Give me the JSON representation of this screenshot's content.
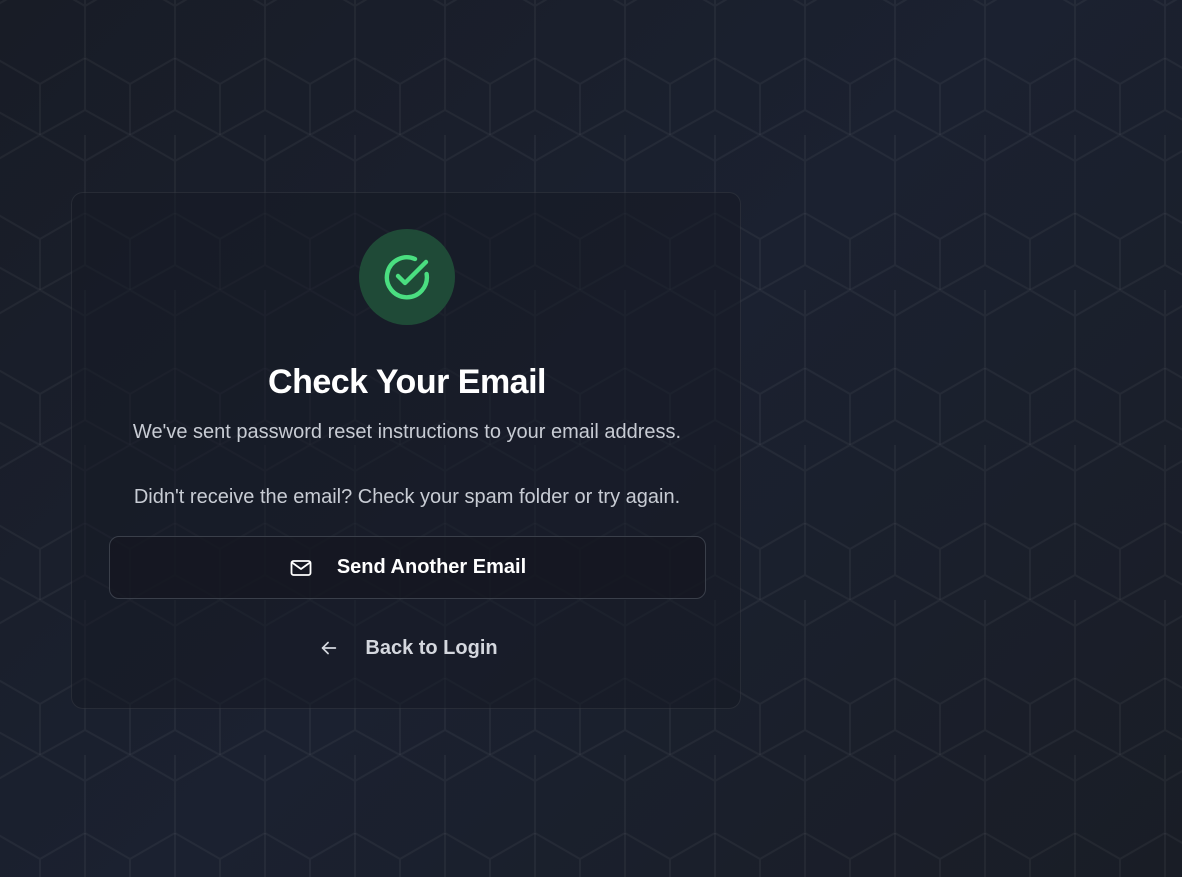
{
  "card": {
    "status_icon": "check-circle-icon",
    "title": "Check Your Email",
    "message": "We've sent password reset instructions to your email address.",
    "hint": "Didn't receive the email? Check your spam folder or try again.",
    "resend_button": {
      "icon": "mail-icon",
      "label": "Send Another Email"
    },
    "back_link": {
      "icon": "arrow-left-icon",
      "label": "Back to Login"
    }
  },
  "colors": {
    "background": "#1a1f2b",
    "success_accent": "#4ade80",
    "success_circle": "#1f4a37",
    "text_primary": "#ffffff",
    "text_secondary": "#c8ccd4",
    "button_border": "#3a3f4a"
  }
}
